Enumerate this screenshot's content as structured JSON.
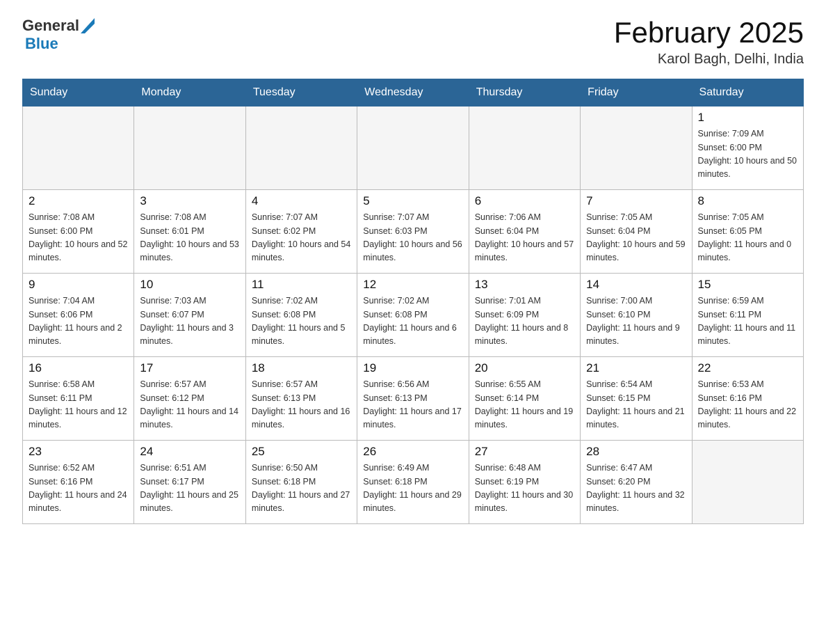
{
  "header": {
    "logo_general": "General",
    "logo_blue": "Blue",
    "title": "February 2025",
    "subtitle": "Karol Bagh, Delhi, India"
  },
  "days": [
    "Sunday",
    "Monday",
    "Tuesday",
    "Wednesday",
    "Thursday",
    "Friday",
    "Saturday"
  ],
  "weeks": [
    [
      {
        "date": "",
        "sunrise": "",
        "sunset": "",
        "daylight": ""
      },
      {
        "date": "",
        "sunrise": "",
        "sunset": "",
        "daylight": ""
      },
      {
        "date": "",
        "sunrise": "",
        "sunset": "",
        "daylight": ""
      },
      {
        "date": "",
        "sunrise": "",
        "sunset": "",
        "daylight": ""
      },
      {
        "date": "",
        "sunrise": "",
        "sunset": "",
        "daylight": ""
      },
      {
        "date": "",
        "sunrise": "",
        "sunset": "",
        "daylight": ""
      },
      {
        "date": "1",
        "sunrise": "Sunrise: 7:09 AM",
        "sunset": "Sunset: 6:00 PM",
        "daylight": "Daylight: 10 hours and 50 minutes."
      }
    ],
    [
      {
        "date": "2",
        "sunrise": "Sunrise: 7:08 AM",
        "sunset": "Sunset: 6:00 PM",
        "daylight": "Daylight: 10 hours and 52 minutes."
      },
      {
        "date": "3",
        "sunrise": "Sunrise: 7:08 AM",
        "sunset": "Sunset: 6:01 PM",
        "daylight": "Daylight: 10 hours and 53 minutes."
      },
      {
        "date": "4",
        "sunrise": "Sunrise: 7:07 AM",
        "sunset": "Sunset: 6:02 PM",
        "daylight": "Daylight: 10 hours and 54 minutes."
      },
      {
        "date": "5",
        "sunrise": "Sunrise: 7:07 AM",
        "sunset": "Sunset: 6:03 PM",
        "daylight": "Daylight: 10 hours and 56 minutes."
      },
      {
        "date": "6",
        "sunrise": "Sunrise: 7:06 AM",
        "sunset": "Sunset: 6:04 PM",
        "daylight": "Daylight: 10 hours and 57 minutes."
      },
      {
        "date": "7",
        "sunrise": "Sunrise: 7:05 AM",
        "sunset": "Sunset: 6:04 PM",
        "daylight": "Daylight: 10 hours and 59 minutes."
      },
      {
        "date": "8",
        "sunrise": "Sunrise: 7:05 AM",
        "sunset": "Sunset: 6:05 PM",
        "daylight": "Daylight: 11 hours and 0 minutes."
      }
    ],
    [
      {
        "date": "9",
        "sunrise": "Sunrise: 7:04 AM",
        "sunset": "Sunset: 6:06 PM",
        "daylight": "Daylight: 11 hours and 2 minutes."
      },
      {
        "date": "10",
        "sunrise": "Sunrise: 7:03 AM",
        "sunset": "Sunset: 6:07 PM",
        "daylight": "Daylight: 11 hours and 3 minutes."
      },
      {
        "date": "11",
        "sunrise": "Sunrise: 7:02 AM",
        "sunset": "Sunset: 6:08 PM",
        "daylight": "Daylight: 11 hours and 5 minutes."
      },
      {
        "date": "12",
        "sunrise": "Sunrise: 7:02 AM",
        "sunset": "Sunset: 6:08 PM",
        "daylight": "Daylight: 11 hours and 6 minutes."
      },
      {
        "date": "13",
        "sunrise": "Sunrise: 7:01 AM",
        "sunset": "Sunset: 6:09 PM",
        "daylight": "Daylight: 11 hours and 8 minutes."
      },
      {
        "date": "14",
        "sunrise": "Sunrise: 7:00 AM",
        "sunset": "Sunset: 6:10 PM",
        "daylight": "Daylight: 11 hours and 9 minutes."
      },
      {
        "date": "15",
        "sunrise": "Sunrise: 6:59 AM",
        "sunset": "Sunset: 6:11 PM",
        "daylight": "Daylight: 11 hours and 11 minutes."
      }
    ],
    [
      {
        "date": "16",
        "sunrise": "Sunrise: 6:58 AM",
        "sunset": "Sunset: 6:11 PM",
        "daylight": "Daylight: 11 hours and 12 minutes."
      },
      {
        "date": "17",
        "sunrise": "Sunrise: 6:57 AM",
        "sunset": "Sunset: 6:12 PM",
        "daylight": "Daylight: 11 hours and 14 minutes."
      },
      {
        "date": "18",
        "sunrise": "Sunrise: 6:57 AM",
        "sunset": "Sunset: 6:13 PM",
        "daylight": "Daylight: 11 hours and 16 minutes."
      },
      {
        "date": "19",
        "sunrise": "Sunrise: 6:56 AM",
        "sunset": "Sunset: 6:13 PM",
        "daylight": "Daylight: 11 hours and 17 minutes."
      },
      {
        "date": "20",
        "sunrise": "Sunrise: 6:55 AM",
        "sunset": "Sunset: 6:14 PM",
        "daylight": "Daylight: 11 hours and 19 minutes."
      },
      {
        "date": "21",
        "sunrise": "Sunrise: 6:54 AM",
        "sunset": "Sunset: 6:15 PM",
        "daylight": "Daylight: 11 hours and 21 minutes."
      },
      {
        "date": "22",
        "sunrise": "Sunrise: 6:53 AM",
        "sunset": "Sunset: 6:16 PM",
        "daylight": "Daylight: 11 hours and 22 minutes."
      }
    ],
    [
      {
        "date": "23",
        "sunrise": "Sunrise: 6:52 AM",
        "sunset": "Sunset: 6:16 PM",
        "daylight": "Daylight: 11 hours and 24 minutes."
      },
      {
        "date": "24",
        "sunrise": "Sunrise: 6:51 AM",
        "sunset": "Sunset: 6:17 PM",
        "daylight": "Daylight: 11 hours and 25 minutes."
      },
      {
        "date": "25",
        "sunrise": "Sunrise: 6:50 AM",
        "sunset": "Sunset: 6:18 PM",
        "daylight": "Daylight: 11 hours and 27 minutes."
      },
      {
        "date": "26",
        "sunrise": "Sunrise: 6:49 AM",
        "sunset": "Sunset: 6:18 PM",
        "daylight": "Daylight: 11 hours and 29 minutes."
      },
      {
        "date": "27",
        "sunrise": "Sunrise: 6:48 AM",
        "sunset": "Sunset: 6:19 PM",
        "daylight": "Daylight: 11 hours and 30 minutes."
      },
      {
        "date": "28",
        "sunrise": "Sunrise: 6:47 AM",
        "sunset": "Sunset: 6:20 PM",
        "daylight": "Daylight: 11 hours and 32 minutes."
      },
      {
        "date": "",
        "sunrise": "",
        "sunset": "",
        "daylight": ""
      }
    ]
  ]
}
